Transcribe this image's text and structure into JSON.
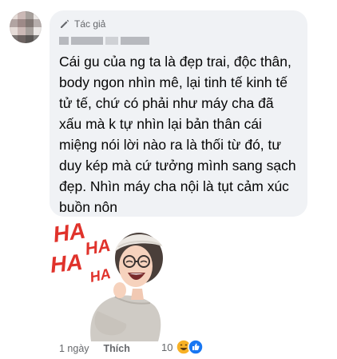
{
  "comment": {
    "author_badge": "Tác giả",
    "text": "Cái gu của ng ta là đẹp trai, độc thân, body ngon nhìn mê, lại tinh tế kinh tế tử tế, chứ có phải như máy cha đã xấu mà k tự nhìn lại bản thân cái miệng nói lời nào ra là thối từ đó, tư duy kép mà cứ tưởng mình sang sạch đẹp. Nhìn máy cha nội là tụt cảm xúc buồn nôn",
    "sticker_text": {
      "ha1": "HA",
      "ha2": "HA",
      "ha3": "HA",
      "ha4": "HA"
    },
    "time": "1 ngày",
    "like_label": "Thích",
    "reaction_count": "10"
  },
  "colors": {
    "bubble_bg": "#f0f2f5",
    "meta_text": "#65676b",
    "sticker_red": "#e0322b",
    "like_blue": "#1877f2",
    "haha_yellow": "#f7b125"
  }
}
